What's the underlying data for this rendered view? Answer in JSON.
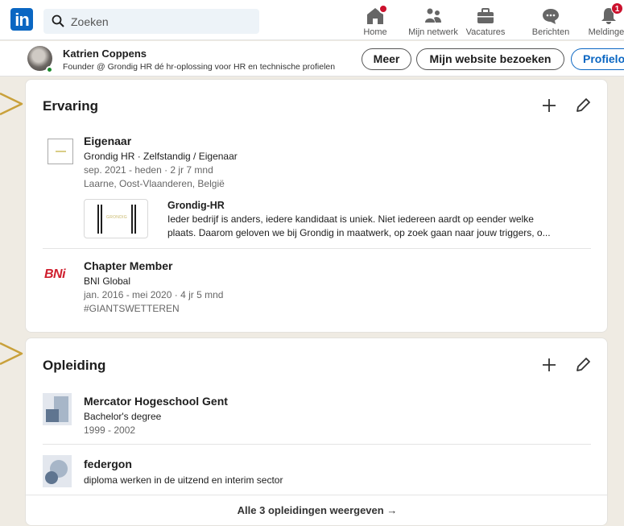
{
  "nav": {
    "logo": "in",
    "search_placeholder": "Zoeken",
    "items": [
      {
        "label": "Home"
      },
      {
        "label": "Mijn netwerk"
      },
      {
        "label": "Vacatures"
      },
      {
        "label": "Berichten"
      },
      {
        "label": "Meldingen",
        "badge": "1"
      }
    ]
  },
  "profile_bar": {
    "name": "Katrien Coppens",
    "headline": "Founder @ Grondig HR dé hr-oplossing voor HR en technische profielen",
    "buttons": {
      "more": "Meer",
      "website": "Mijn website bezoeken",
      "language": "Profielo"
    }
  },
  "experience": {
    "title": "Ervaring",
    "items": [
      {
        "role": "Eigenaar",
        "company": "Grondig HR · Zelfstandig / Eigenaar",
        "dates": "sep. 2021 - heden · 2 jr 7 mnd",
        "location": "Laarne, Oost-Vlaanderen, België",
        "media": {
          "thumb_text": "GRONDIG",
          "title": "Grondig-HR",
          "desc_line1": "Ieder bedrijf is anders, iedere kandidaat is uniek. Niet iedereen aardt op eender welke",
          "desc_line2": "plaats. Daarom geloven we bij Grondig in maatwerk, op zoek gaan naar jouw triggers, o..."
        }
      },
      {
        "logo_text": "BNi",
        "role": "Chapter Member",
        "company": "BNI Global",
        "dates": "jan. 2016 - mei 2020 · 4 jr 5 mnd",
        "tag": "#GIANTSWETTEREN"
      }
    ]
  },
  "education": {
    "title": "Opleiding",
    "items": [
      {
        "school": "Mercator Hogeschool Gent",
        "degree": "Bachelor's degree",
        "dates": "1999 - 2002"
      },
      {
        "school": "federgon",
        "degree": "diploma werken in de uitzend en interim sector"
      }
    ],
    "show_all": "Alle 3 opleidingen weergeven →"
  },
  "colors": {
    "brand": "#0a66c2",
    "notification": "#cb112d",
    "arrow": "#c9a13b",
    "bni_red": "#cf1f2e"
  }
}
